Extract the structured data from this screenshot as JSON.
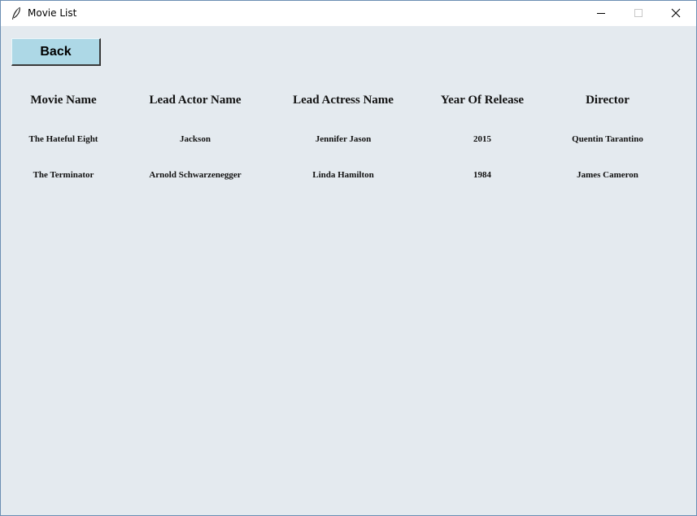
{
  "window": {
    "title": "Movie List",
    "icon": "feather-icon",
    "controls": [
      "minimize-icon",
      "maximize-icon",
      "close-icon"
    ]
  },
  "toolbar": {
    "back_label": "Back"
  },
  "table": {
    "headers": [
      "Movie Name",
      "Lead Actor Name",
      "Lead Actress Name",
      "Year Of Release",
      "Director"
    ],
    "rows": [
      [
        "The Hateful Eight",
        "Jackson",
        "Jennifer Jason",
        "2015",
        "Quentin Tarantino"
      ],
      [
        "The Terminator",
        "Arnold Schwarzenegger",
        "Linda Hamilton",
        "1984",
        "James Cameron"
      ]
    ]
  },
  "colors": {
    "window_bg": "#e4eaef",
    "button_bg": "#add8e6"
  }
}
